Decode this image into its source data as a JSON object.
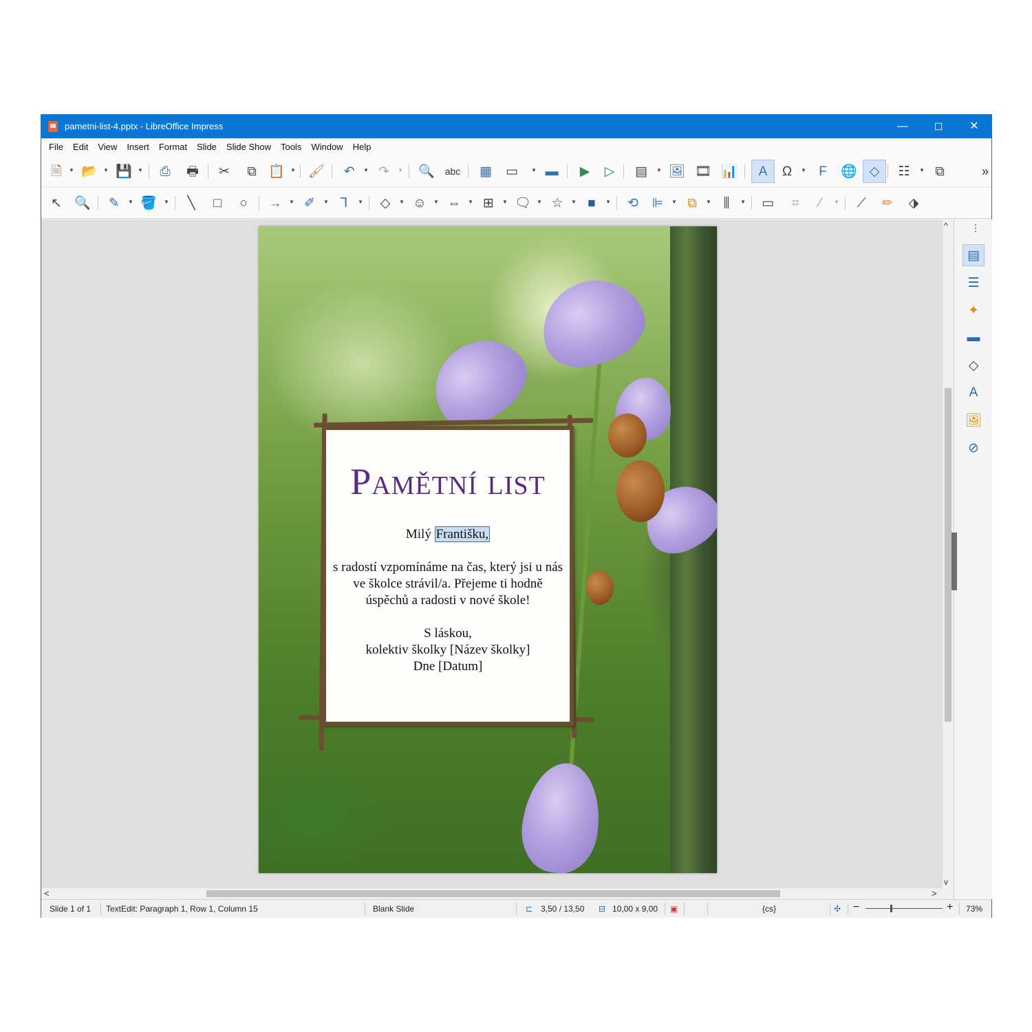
{
  "window": {
    "title": "pametni-list-4.pptx - LibreOffice Impress",
    "controls": {
      "minimize": "—",
      "maximize": "☐",
      "close": "✕"
    }
  },
  "menu": [
    "File",
    "Edit",
    "View",
    "Insert",
    "Format",
    "Slide",
    "Slide Show",
    "Tools",
    "Window",
    "Help"
  ],
  "toolbar_icons": {
    "new": "🗎",
    "open": "📂",
    "save": "💾",
    "export_pdf": "⎙",
    "print": "🖶",
    "cut": "✂",
    "copy": "⧉",
    "paste": "📋",
    "clone": "🖌",
    "undo": "↶",
    "redo": "↷",
    "find": "🔍",
    "spelling": "abc",
    "grid": "▦",
    "display_views": "▭",
    "master_slide": "▬",
    "start_first": "▶",
    "start_current": "▷",
    "table": "▤",
    "image": "🖼",
    "media": "🎞",
    "chart": "📊",
    "textbox": "A",
    "special_char": "Ω",
    "fontwork": "F",
    "hyperlink": "🌐",
    "points": "◇",
    "new_slide": "☷",
    "duplicate_slide": "⧉",
    "more": "»"
  },
  "drawing_icons": {
    "select": "↖",
    "zoom": "🔍",
    "line_color": "✎",
    "fill_color": "🪣",
    "line": "╲",
    "rectangle": "□",
    "ellipse": "○",
    "arrow_line": "→",
    "curve": "✐",
    "connector": "⅂",
    "basic_shapes": "◇",
    "symbol_shapes": "☺",
    "block_arrows": "⇔",
    "flowchart": "⊞",
    "callouts": "🗨",
    "stars": "☆",
    "3d_objects": "■",
    "rotate": "⟲",
    "align": "⊫",
    "arrange": "⧉",
    "distribute": "⫼",
    "shadow": "▭",
    "crop": "⌗",
    "filter": "⁄",
    "point_edit": "⟋",
    "glue": "✏",
    "toggle_extrusion": "⬗"
  },
  "slide": {
    "title": "Pamětní list",
    "greeting_prefix": "Milý ",
    "greeting_name": "Františku,",
    "paragraph_1": "s radostí vzpomínáme na čas, který jsi u nás ve školce strávil/a. Přejeme ti hodně úspěchů a radosti v nové škole!",
    "closing_1": "S láskou,",
    "closing_2": "kolektiv školky [Název školky]",
    "closing_3": "Dne [Datum]"
  },
  "sidebar": {
    "menu": "⋮",
    "buttons": [
      "properties-icon",
      "styles-icon",
      "animation-icon",
      "master-slides-icon",
      "shapes-icon",
      "gallery-icon",
      "image-gallery-icon",
      "navigator-icon"
    ],
    "glyphs": [
      "▤",
      "☰",
      "✦",
      "▬",
      "◇",
      "A",
      "🖼",
      "⊘"
    ]
  },
  "statusbar": {
    "slide": "Slide 1 of 1",
    "textedit": "TextEdit: Paragraph 1, Row 1, Column 15",
    "layout": "Blank Slide",
    "position": "3,50 / 13,50",
    "size": "10,00 x 9,00",
    "language": "{cs}",
    "zoom": "73%",
    "zoom_minus": "−",
    "zoom_plus": "+"
  },
  "scroll": {
    "up": "^",
    "down": "v",
    "left": "<",
    "right": ">"
  },
  "colors": {
    "titlebar": "#0b77d4",
    "accent": "#2a6cb5",
    "slide_title": "#5a2b86"
  }
}
